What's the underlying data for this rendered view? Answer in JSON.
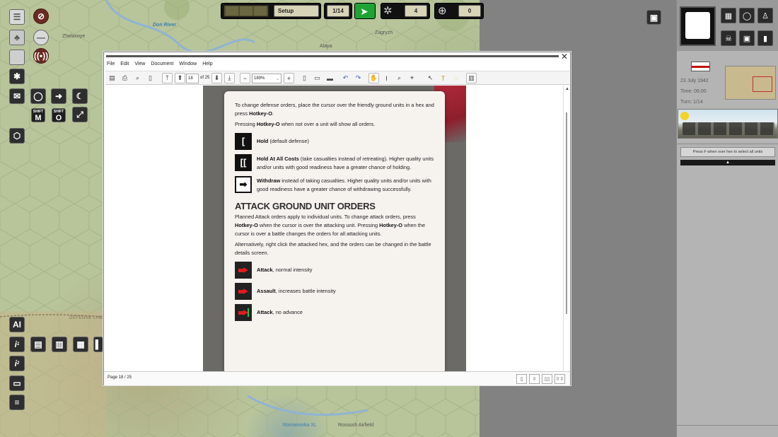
{
  "map": {
    "labels": {
      "river": "Don River",
      "town1": "Zhelavoye",
      "town2": "Zagryzh",
      "town3": "Alaya",
      "front": "DEFENSE LINE",
      "south1": "Romanovka XL",
      "south2": "Rossosh\nAirfield"
    }
  },
  "top_toolbar": {
    "phase": "Setup",
    "turn_counter": "1/14",
    "recon_count": "4",
    "target_count": "0"
  },
  "left_tools": {
    "shift_m_top": "SHIFT",
    "shift_m": "M",
    "shift_o_top": "SHIFT",
    "shift_o": "O",
    "ai_label": "AI",
    "info1": "i",
    "info1_sup": "1",
    "info2": "i",
    "info2_sup": "2"
  },
  "viewer": {
    "menu": [
      "File",
      "Edit",
      "View",
      "Document",
      "Window",
      "Help"
    ],
    "page_input": "18",
    "page_of": "of 25",
    "zoom": "189%",
    "status_page": "Page 18 / 25",
    "doc": {
      "p1a": "To change defense orders, place the cursor over the friendly ground units in a hex and press ",
      "p1b": "Hotkey-O",
      "p1c": ".",
      "p2a": "Pressing ",
      "p2b": "Hotkey-O",
      "p2c": " when not over a unit will show all orders.",
      "hold_name": "Hold",
      "hold_desc": " (default defense)",
      "hac_name": "Hold At All Costs",
      "hac_desc": " (take casualties instead of retreating). Higher quality units and/or units with good readiness have a greater chance of holding.",
      "wd_name": "Withdraw",
      "wd_desc": " instead of taking casualties. Higher quality units and/or units with good readiness have a greater chance of withdrawing successfully.",
      "heading": "ATTACK GROUND UNIT ORDERS",
      "p3a": "Planned Attack orders apply to individual units. To change attack orders, press ",
      "p3b": "Hotkey-O",
      "p3c": " when the cursor is over the attacking unit. Pressing ",
      "p3d": "Hotkey-O",
      "p3e": " when the cursor is over a battle changes the orders for all attacking units.",
      "p4": "Alternatively, right click the attacked hex, and the orders can be changed in the battle details screen.",
      "atk_name": "Attack",
      "atk_desc": ", normal intensity",
      "as_name": "Assault",
      "as_desc": ", increases battle intensity",
      "an_name": "Attack",
      "an_desc": ", no advance"
    }
  },
  "right_panel": {
    "date": "23 July 1942",
    "time": "Time: 06:00",
    "turn": "Turn: 1/14",
    "hint": "Press F when over hex to select all units",
    "expander": "▲"
  },
  "colors": {
    "accent_green": "#1fa335",
    "attack_red": "#e01b1b",
    "panel_gray": "#b4b4b4"
  }
}
